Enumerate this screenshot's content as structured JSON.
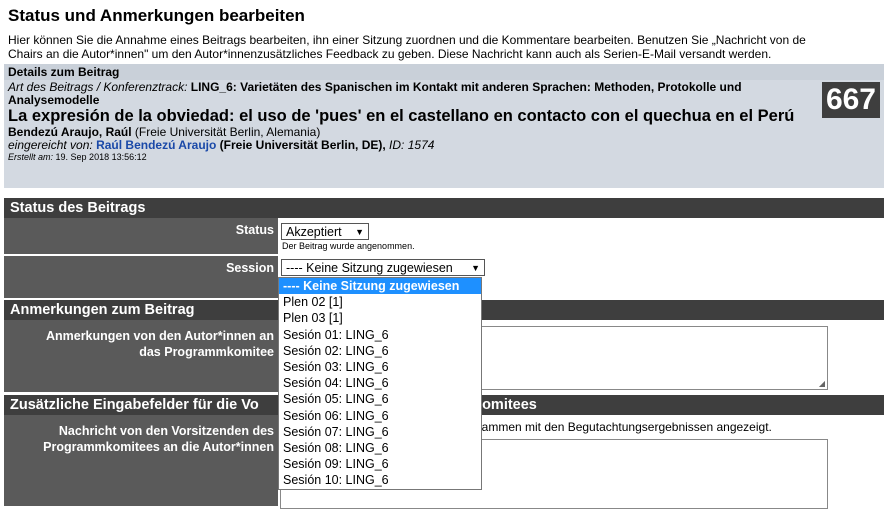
{
  "page": {
    "title": "Status und Anmerkungen bearbeiten",
    "intro_line1": "Hier können Sie die Annahme eines Beitrags bearbeiten, ihn einer Sitzung zuordnen und die Kommentare bearbeiten. Benutzen Sie „Nachricht von de",
    "intro_line2": "Chairs an die Autor*innen\" um den Autor*innenzusätzliches Feedback zu geben. Diese Nachricht kann auch als Serien-E-Mail versandt werden."
  },
  "details": {
    "header": "Details zum Beitrag",
    "track_label": "Art des Beitrags / Konferenztrack:",
    "track_value_line1": "LING_6: Varietäten des Spanischen im Kontakt mit anderen Sprachen: Methoden, Protokolle und",
    "track_value_line2": "Analysemodelle",
    "paper_title": "La expresión de la obviedad: el uso de 'pues' en el castellano en contacto con el quechua en el Perú",
    "author": "Bendezú Araujo, Raúl",
    "affiliation": "(Freie Universität Berlin, Alemania)",
    "submitted_label": "eingereicht von:",
    "submitter_name": "Raúl Bendezú Araujo",
    "submitter_affil": "(Freie Universität Berlin, DE),",
    "id_label": "ID:",
    "id_value": "1574",
    "created_label": "Erstellt am:",
    "created_value": "19. Sep 2018 13:56:12",
    "badge_number": "667"
  },
  "status_section": {
    "header": "Status des Beitrags",
    "status_label": "Status",
    "status_value": "Akzeptiert",
    "status_hint": "Der Beitrag wurde angenommen.",
    "session_label": "Session",
    "session_value": "---- Keine Sitzung zugewiesen"
  },
  "session_options": [
    "---- Keine Sitzung zugewiesen",
    "Plen 02 [1]",
    "Plen 03 [1]",
    "Sesión 01: LING_6",
    "Sesión 02: LING_6",
    "Sesión 03: LING_6",
    "Sesión 04: LING_6",
    "Sesión 05: LING_6",
    "Sesión 06: LING_6",
    "Sesión 07: LING_6",
    "Sesión 08: LING_6",
    "Sesión 09: LING_6",
    "Sesión 10: LING_6"
  ],
  "notes_section": {
    "header": "Anmerkungen zum Beitrag",
    "label_line1": "Anmerkungen von den Autor*innen an",
    "label_line2": "das Programmkomitee"
  },
  "extra_section": {
    "header_part1": "Zusätzliche Eingabefelder für die Vo",
    "header_part2": "komitees",
    "label_line1": "Nachricht von den Vorsitzenden des",
    "label_line2": "Programmkomitees an die Autor*innen",
    "hint_part": "usammen mit den Begutachtungsergebnissen angezeigt."
  },
  "colors": {
    "section_header_bg": "#3e3e3e",
    "details_bg": "#d3d9e1",
    "link_blue": "#1a49a8",
    "dropdown_selected": "#1e90ff"
  }
}
